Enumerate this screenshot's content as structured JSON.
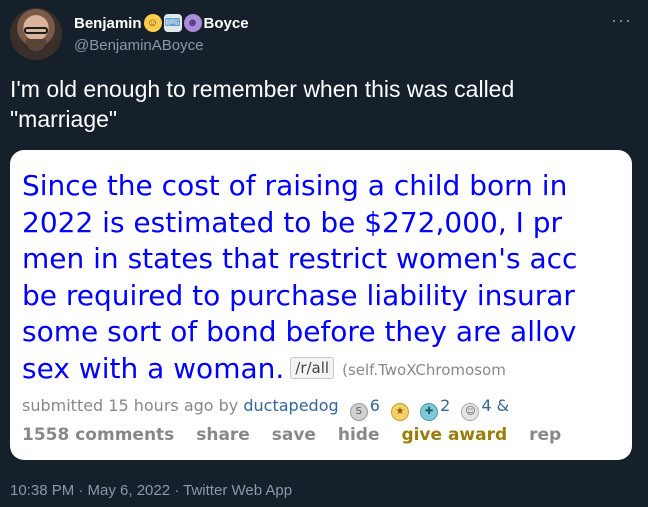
{
  "author": {
    "name_part1": "Benjamin",
    "name_part2": "Boyce",
    "emoji": [
      "angel-face-emoji",
      "technologist-emoji",
      "devil-face-emoji"
    ],
    "handle": "@BenjaminABoyce"
  },
  "tweet": {
    "text_line1": "I'm old enough to remember when this was called",
    "text_line2": "\"marriage\""
  },
  "screenshot": {
    "title_lines": [
      "Since the cost of raising a child born in",
      "2022 is estimated to be $272,000, I pr",
      "men in states that restrict women's acc",
      "be required to purchase liability insurar",
      "some sort of bond before they are allov",
      "sex with a woman."
    ],
    "subreddit_flair": "/r/all",
    "domain": "(self.TwoXChromosom",
    "submitted_text": "submitted 15 hours ago by",
    "author": "ductapedog",
    "awards": [
      {
        "icon": "silver-award-icon",
        "count": "6"
      },
      {
        "icon": "wholesome-award-icon",
        "count": "2"
      },
      {
        "icon": "face-award-icon",
        "count": "4 &"
      }
    ],
    "actions": {
      "comments": "1558 comments",
      "share": "share",
      "save": "save",
      "hide": "hide",
      "give_award": "give award",
      "report": "rep"
    }
  },
  "footer": {
    "timestamp": "10:38 PM · May 6, 2022 · Twitter Web App"
  },
  "colors": {
    "background": "#15202b",
    "secondary_text": "#8b98a5",
    "reddit_link": "#0000ff"
  }
}
